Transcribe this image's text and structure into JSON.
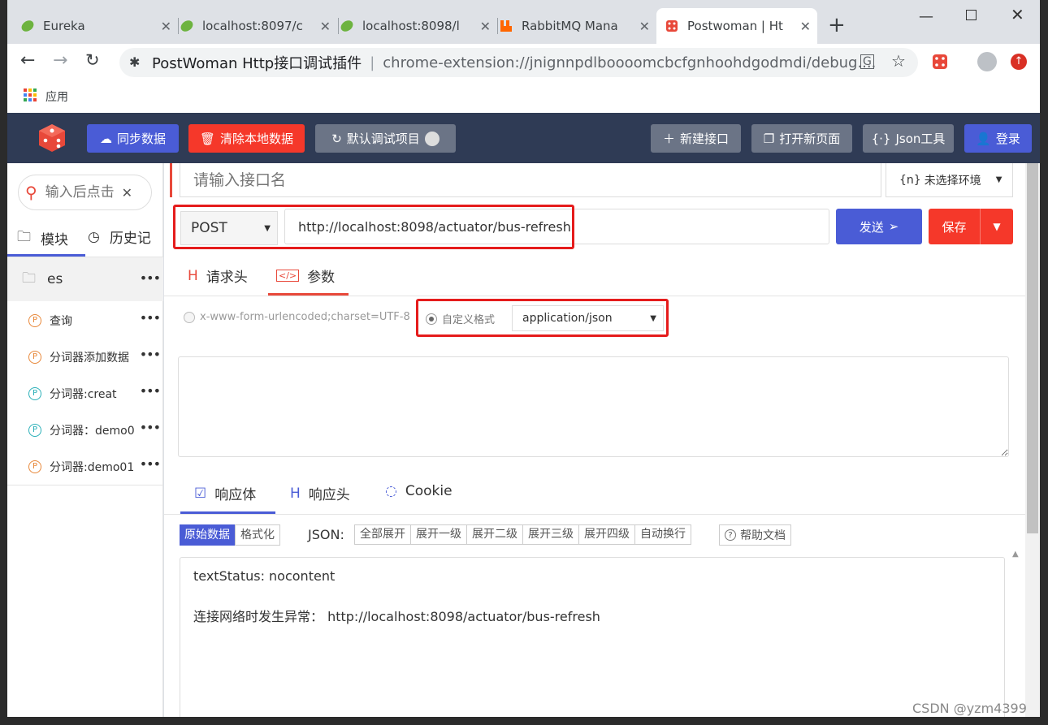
{
  "browser": {
    "tabs": [
      {
        "title": "Eureka",
        "icon": "spring-leaf-icon"
      },
      {
        "title": "localhost:8097/c",
        "icon": "spring-leaf-icon"
      },
      {
        "title": "localhost:8098/l",
        "icon": "spring-leaf-icon"
      },
      {
        "title": "RabbitMQ Mana",
        "icon": "rabbitmq-icon"
      },
      {
        "title": "Postwoman | Ht",
        "icon": "dice-icon"
      }
    ],
    "new_tab": "+",
    "address": {
      "title": "PostWoman Http接口调试插件",
      "separator": "|",
      "url": "chrome-extension://jnignnpdlboooomcbcfgnhoohdgodmdi/debug...."
    },
    "bookmarks": {
      "apps_label": "应用"
    }
  },
  "app": {
    "header": {
      "sync": "同步数据",
      "clear": "清除本地数据",
      "default_project": "默认调试项目",
      "new_api": "新建接口",
      "open_page": "打开新页面",
      "json_tool": "Json工具",
      "login": "登录"
    },
    "sidebar": {
      "search_placeholder": "输入后点击",
      "tabs": {
        "modules": "模块",
        "history": "历史记"
      },
      "folder": "es",
      "items": [
        {
          "label": "查询",
          "badge": "P",
          "color": "orange"
        },
        {
          "label": "分词器添加数据",
          "badge": "P",
          "color": "orange"
        },
        {
          "label": "分词器:creat",
          "badge": "P",
          "color": "teal"
        },
        {
          "label": "分词器：demo0",
          "badge": "P",
          "color": "teal"
        },
        {
          "label": "分词器:demo01",
          "badge": "P",
          "color": "orange"
        }
      ],
      "more": "•••"
    },
    "request": {
      "name_placeholder": "请输入接口名",
      "env": {
        "prefix": "{n}",
        "label": "未选择环境"
      },
      "method": "POST",
      "url": "http://localhost:8098/actuator/bus-refresh",
      "send": "发送",
      "save": "保存",
      "tabs": {
        "headers": "请求头",
        "params": "参数"
      },
      "content_types": {
        "form": "x-www-form-urlencoded;charset=UTF-8",
        "custom": "自定义格式"
      },
      "custom_format": "application/json",
      "body": ""
    },
    "response": {
      "tabs": {
        "body": "响应体",
        "headers": "响应头",
        "cookie": "Cookie"
      },
      "view": {
        "raw": "原始数据",
        "formatted": "格式化"
      },
      "json_label": "JSON:",
      "json_buttons": [
        "全部展开",
        "展开一级",
        "展开二级",
        "展开三级",
        "展开四级",
        "自动换行"
      ],
      "help": "帮助文档",
      "lines": [
        "textStatus: nocontent",
        "连接网络时发生异常：  http://localhost:8098/actuator/bus-refresh"
      ]
    }
  },
  "watermark": "CSDN @yzm4399",
  "colors": {
    "appbar": "#2f3b55",
    "primary": "#4a5cd6",
    "danger": "#f5382a",
    "highlight": "#e51c1c",
    "accent": "#e8483a"
  }
}
